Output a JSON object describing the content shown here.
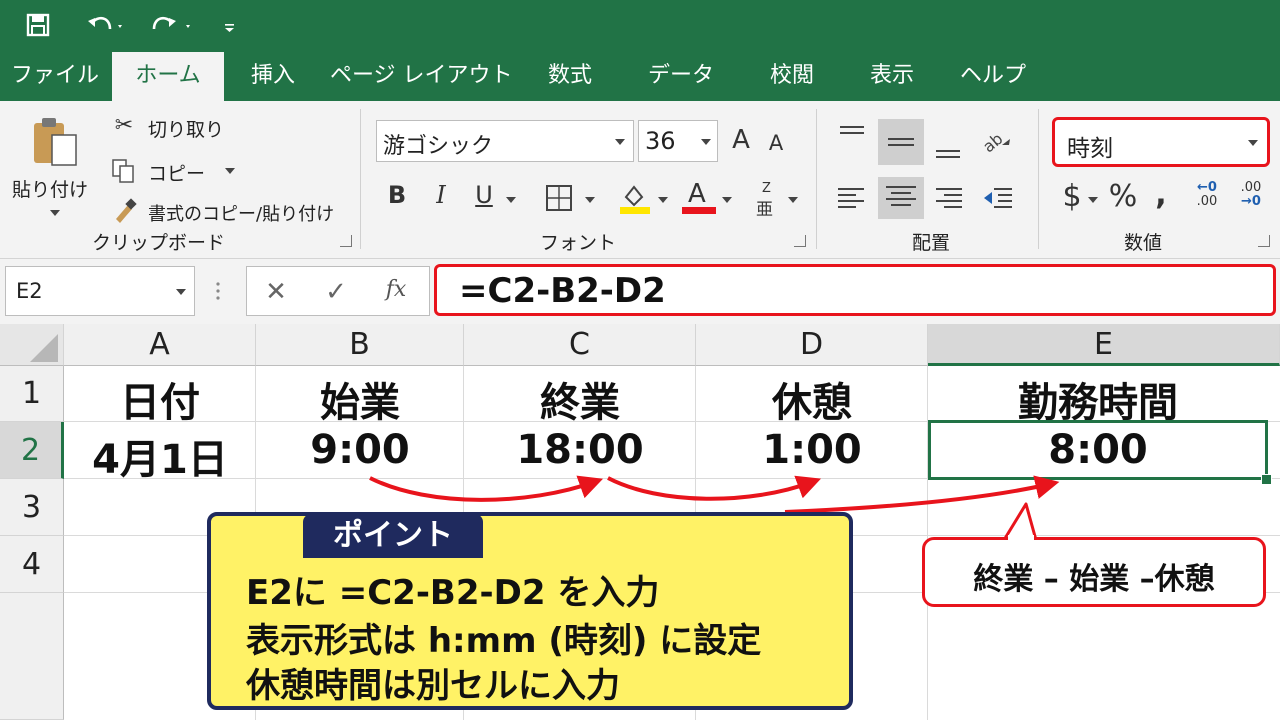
{
  "colors": {
    "excel_green": "#217346",
    "highlight_red": "#e8141c",
    "point_yellow": "#fff266",
    "point_navy": "#1f2a5e"
  },
  "quick_access": {
    "icons": [
      "save-icon",
      "undo-icon",
      "redo-icon",
      "customize-icon"
    ]
  },
  "tabs": [
    "ファイル",
    "ホーム",
    "挿入",
    "ページ レイアウト",
    "数式",
    "データ",
    "校閲",
    "表示",
    "ヘルプ"
  ],
  "ribbon": {
    "clipboard": {
      "paste": "貼り付け",
      "cut": "切り取り",
      "copy": "コピー",
      "format_painter": "書式のコピー/貼り付け",
      "label": "クリップボード"
    },
    "font": {
      "name": "游ゴシック",
      "size": "36",
      "grow": "A",
      "shrink": "A",
      "bold": "B",
      "italic": "I",
      "underline": "U",
      "font_color": "A",
      "phonetic": "Z",
      "phonetic_sub": "亜",
      "label": "フォント"
    },
    "alignment": {
      "label": "配置"
    },
    "number": {
      "format": "時刻",
      "currency": "$",
      "percent": "%",
      "comma": ",",
      "inc_decimal_top": "←0",
      "inc_decimal_bottom": ".00",
      "dec_decimal_top": ".00",
      "dec_decimal_bottom": "→0",
      "label": "数値"
    }
  },
  "formula_bar": {
    "name_box": "E2",
    "formula": "=C2-B2-D2",
    "fx": "fx"
  },
  "sheet": {
    "columns": [
      "A",
      "B",
      "C",
      "D",
      "E"
    ],
    "rows": [
      "1",
      "2",
      "3",
      "4"
    ],
    "header_row": [
      "日付",
      "始業",
      "終業",
      "休憩",
      "勤務時間"
    ],
    "data_row": [
      "4月1日",
      "9:00",
      "18:00",
      "1:00",
      "8:00"
    ],
    "selected_cell": "E2"
  },
  "callout_point": {
    "tag": "ポイント",
    "lines": [
      "E2に =C2-B2-D2 を入力",
      "表示形式は h:mm (時刻) に設定",
      "休憩時間は別セルに入力"
    ]
  },
  "callout_note": "終業 – 始業 –休憩"
}
